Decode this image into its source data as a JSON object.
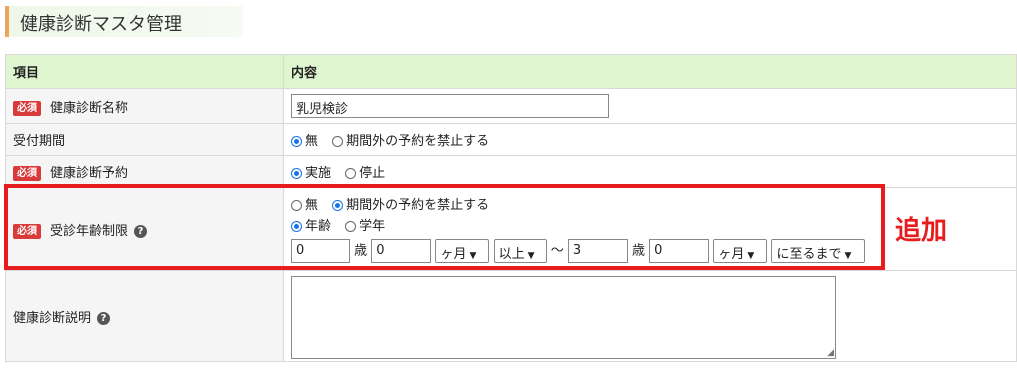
{
  "page": {
    "title": "健康診断マスタ管理"
  },
  "table": {
    "header": {
      "item": "項目",
      "content": "内容"
    },
    "required_badge": "必須",
    "rows": {
      "name": {
        "label": "健康診断名称",
        "value": "乳児検診"
      },
      "reception": {
        "label": "受付期間",
        "options": [
          "無",
          "期間外の予約を禁止する"
        ],
        "selected": "無"
      },
      "reservation": {
        "label": "健康診断予約",
        "options": [
          "実施",
          "停止"
        ],
        "selected": "実施"
      },
      "age_limit": {
        "label": "受診年齢制限",
        "options": [
          "無",
          "期間外の予約を禁止する"
        ],
        "selected": "期間外の予約を禁止する",
        "basis_options": [
          "年齢",
          "学年"
        ],
        "basis_selected": "年齢",
        "from_years": "0",
        "years_unit": "歳",
        "from_months": "0",
        "months_select": "ヶ月",
        "comparator": "以上",
        "tilde": "〜",
        "to_years": "3",
        "to_months": "0",
        "until": "に至るまで"
      },
      "description": {
        "label": "健康診断説明",
        "value": ""
      }
    }
  },
  "annotation": {
    "text": "追加",
    "color": "#e81c1c"
  }
}
